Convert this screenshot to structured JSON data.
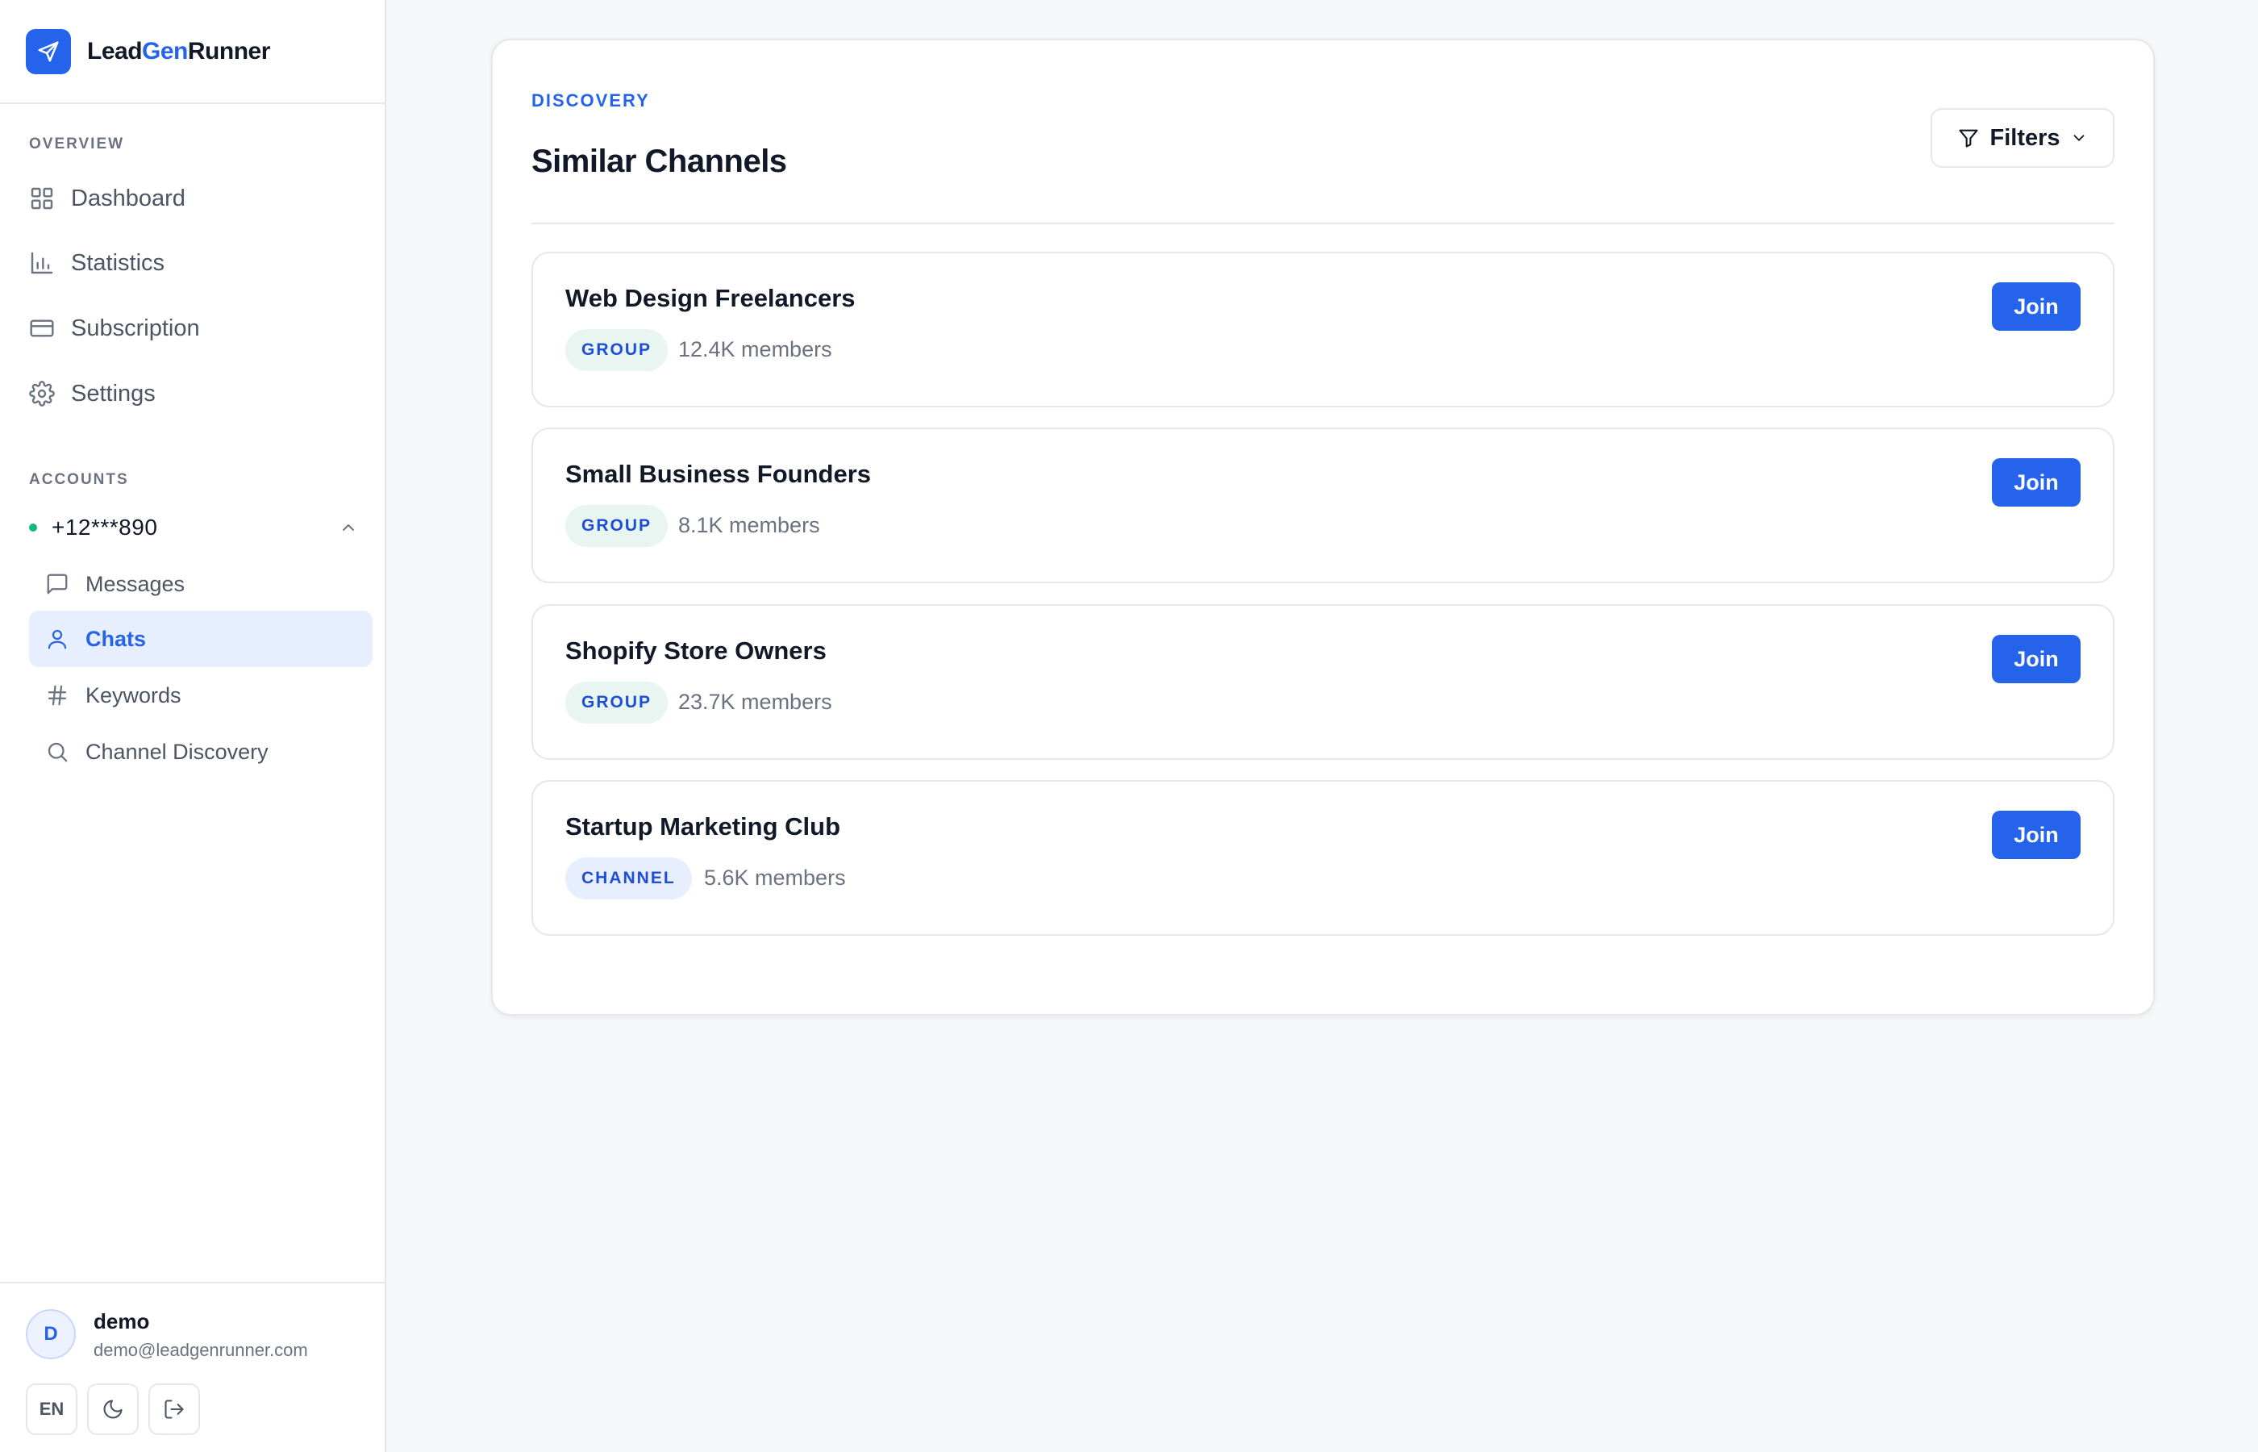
{
  "app": {
    "name_prefix": "Lead",
    "name_accent": "Gen",
    "name_suffix": "Runner"
  },
  "sidebar": {
    "overview_label": "OVERVIEW",
    "nav": [
      {
        "label": "Dashboard",
        "icon": "grid-icon"
      },
      {
        "label": "Statistics",
        "icon": "bar-chart-icon"
      },
      {
        "label": "Subscription",
        "icon": "credit-card-icon"
      },
      {
        "label": "Settings",
        "icon": "gear-icon"
      }
    ],
    "accounts_label": "ACCOUNTS",
    "account": {
      "number": "+12***890",
      "status_color": "#10b981",
      "items": [
        {
          "label": "Messages",
          "icon": "message-icon"
        },
        {
          "label": "Chats",
          "icon": "user-icon",
          "active": true
        },
        {
          "label": "Keywords",
          "icon": "hash-icon"
        },
        {
          "label": "Channel Discovery",
          "icon": "search-icon"
        }
      ]
    },
    "user": {
      "initial": "D",
      "name": "demo",
      "email": "demo@leadgenrunner.com"
    },
    "footer_buttons": {
      "language": "EN",
      "theme_icon": "moon-icon",
      "logout_icon": "logout-icon"
    }
  },
  "main": {
    "eyebrow": "DISCOVERY",
    "title": "Similar Channels",
    "filters_label": "Filters",
    "join_label": "Join",
    "channels": [
      {
        "name": "Web Design Freelancers",
        "type": "GROUP",
        "members": "12.4K members"
      },
      {
        "name": "Small Business Founders",
        "type": "GROUP",
        "members": "8.1K members"
      },
      {
        "name": "Shopify Store Owners",
        "type": "GROUP",
        "members": "23.7K members"
      },
      {
        "name": "Startup Marketing Club",
        "type": "CHANNEL",
        "members": "5.6K members"
      }
    ]
  },
  "colors": {
    "accent": "#2563eb",
    "active_bg": "#e7efff",
    "group_badge_bg": "#e8f5f1",
    "channel_badge_bg": "#e7efff"
  }
}
